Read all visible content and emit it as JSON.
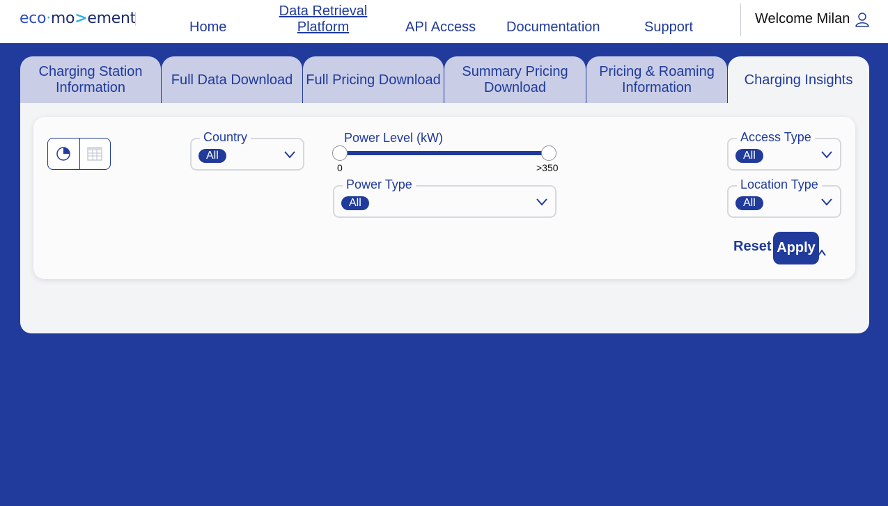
{
  "header": {
    "logo": {
      "part1": "eco",
      "part2": "mo",
      "arrow": ">",
      "part3": "ement"
    },
    "nav": {
      "home": "Home",
      "data_retrieval_line1": "Data Retrieval",
      "data_retrieval_line2": "Platform",
      "api_access": "API Access",
      "documentation": "Documentation",
      "support": "Support"
    },
    "welcome": "Welcome Milan",
    "user_icon": "user-icon"
  },
  "tabs": [
    {
      "line1": "Charging Station",
      "line2": "Information",
      "active": false
    },
    {
      "line1": "Full Data Download",
      "line2": "",
      "active": false
    },
    {
      "line1": "Full Pricing Download",
      "line2": "",
      "active": false
    },
    {
      "line1": "Summary Pricing",
      "line2": "Download",
      "active": false
    },
    {
      "line1": "Pricing & Roaming",
      "line2": "Information",
      "active": false
    },
    {
      "line1": "Charging Insights",
      "line2": "",
      "active": true
    }
  ],
  "filters": {
    "view_toggle": {
      "chart_icon": "pie-chart-icon",
      "table_icon": "table-icon"
    },
    "country": {
      "label": "Country",
      "value": "All"
    },
    "power_level": {
      "label": "Power Level (kW)",
      "min_label": "0",
      "max_label": ">350"
    },
    "power_type": {
      "label": "Power Type",
      "value": "All"
    },
    "access_type": {
      "label": "Access Type",
      "value": "All"
    },
    "location_type": {
      "label": "Location Type",
      "value": "All"
    },
    "reset_label": "Reset",
    "apply_label": "Apply"
  },
  "colors": {
    "brand": "#203b9b",
    "tab_inactive": "#c9cde6",
    "panel": "#f3f4f6",
    "logo_accent": "#2db3e0"
  }
}
